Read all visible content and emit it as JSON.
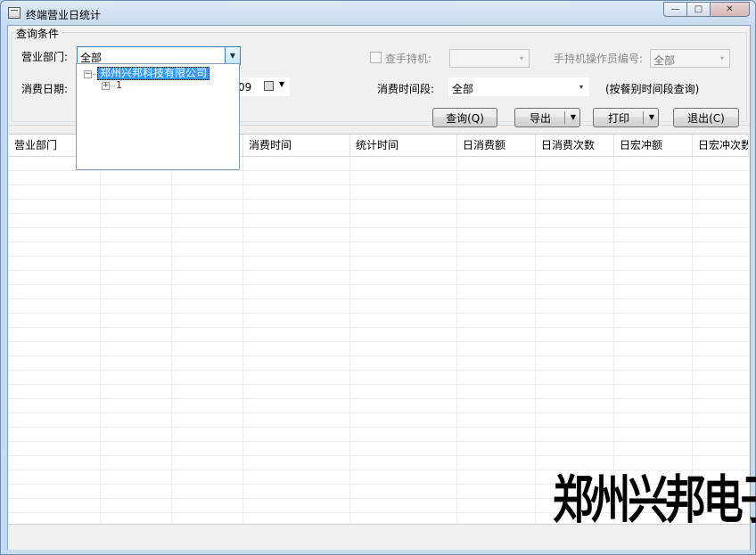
{
  "window": {
    "title": "终端营业日统计",
    "min_glyph": "—",
    "max_glyph": "□",
    "close_glyph": "✕"
  },
  "query": {
    "group_title": "查询条件",
    "dept_label": "营业部门:",
    "dept_value": "全部",
    "date_label": "消费日期:",
    "date_value_tail": "09",
    "handheld_label": "查手持机:",
    "operator_label": "手持机操作员编号:",
    "operator_value": "全部",
    "period_label": "消费时间段:",
    "period_value": "全部",
    "period_hint": "(按餐别时间段查询)"
  },
  "buttons": {
    "query": "查询(Q)",
    "export": "导出",
    "print": "打印",
    "exit": "退出(C)"
  },
  "tree": {
    "root": "郑州兴邦科技有限公司",
    "child": "1",
    "minus_glyph": "−",
    "plus_glyph": "+"
  },
  "grid": {
    "columns": [
      "营业部门",
      "",
      "",
      "消费时间",
      "统计时间",
      "日消费额",
      "日消费次数",
      "日宏冲额",
      "日宏冲次数"
    ]
  },
  "watermark": "郑州兴邦电子",
  "glyphs": {
    "dropdown": "▼",
    "small_dropdown": "▾"
  }
}
